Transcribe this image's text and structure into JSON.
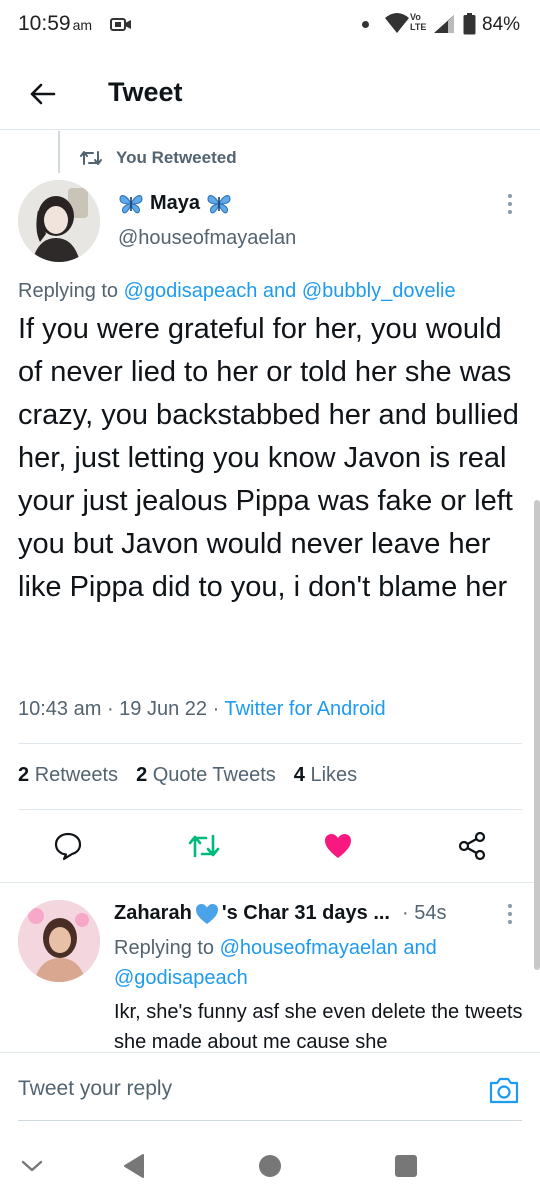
{
  "status_bar": {
    "time": "10:59",
    "ampm": "am",
    "network": "Vo LTE",
    "battery": "84%"
  },
  "header": {
    "title": "Tweet"
  },
  "retweet_context": {
    "label": "You Retweeted"
  },
  "tweet": {
    "author_name": "Maya",
    "author_handle": "@houseofmayaelan",
    "replying_prefix": "Replying to",
    "replying_user1": "@godisapeach",
    "replying_and": "and",
    "replying_user2": "@bubbly_dovelie",
    "body": "If you were grateful for her, you would of never lied to her or told her she was crazy, you backstabbed her and bullied her, just letting you know Javon is real your just jealous Pippa was fake or left you but Javon would never leave her like Pippa did to you, i don't blame her",
    "time": "10:43 am",
    "date": "19 Jun 22",
    "source": "Twitter for Android",
    "retweets_count": "2",
    "retweets_label": "Retweets",
    "quote_count": "2",
    "quote_label": "Quote Tweets",
    "likes_count": "4",
    "likes_label": "Likes"
  },
  "reply": {
    "name_part1": "Zaharah",
    "name_part2": "'s Char 31 days ...",
    "time": "54s",
    "replying_prefix": "Replying to",
    "replying_user1": "@houseofmayaelan",
    "replying_and": "and",
    "replying_user2": "@godisapeach",
    "text": "Ikr, she's funny asf she even delete the tweets she made about me cause she"
  },
  "reply_bar": {
    "placeholder": "Tweet your reply"
  },
  "colors": {
    "accent": "#1d9bf0",
    "retweet_green": "#00ba7c",
    "like_pink": "#f91880",
    "muted": "#536471"
  },
  "icons": {
    "back": "arrow-left-icon",
    "retweet_context": "retweet-icon",
    "more": "more-vertical-icon",
    "reply": "reply-bubble-icon",
    "retweet": "retweet-icon",
    "like": "heart-icon",
    "share": "share-icon",
    "camera": "camera-icon",
    "butterfly": "butterfly-emoji",
    "blue_heart": "blue-heart-emoji"
  }
}
